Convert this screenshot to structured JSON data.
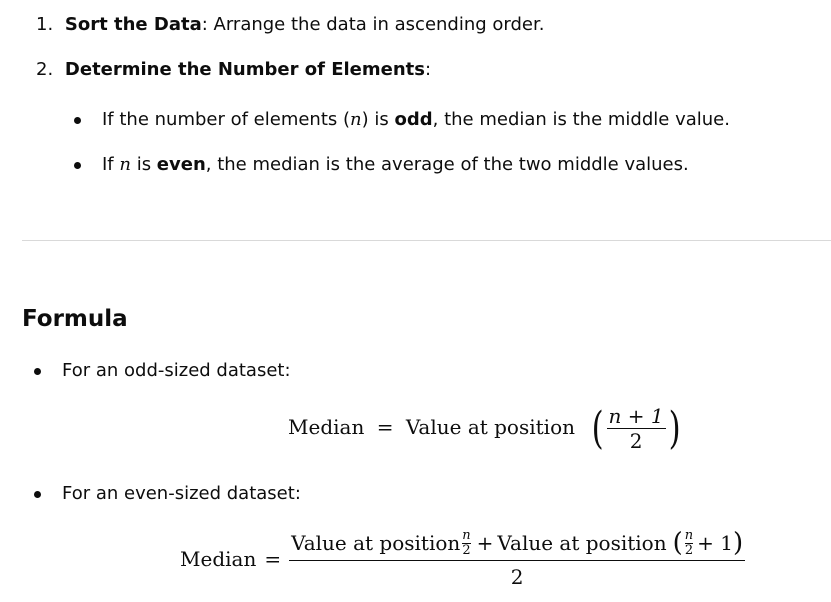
{
  "steps": [
    {
      "num": "1.",
      "title": "Sort the Data",
      "rest": ": Arrange the data in ascending order."
    },
    {
      "num": "2.",
      "title": "Determine the Number of Elements",
      "rest": ":"
    }
  ],
  "sub_bullets": {
    "odd": {
      "pre": "If the number of elements (",
      "var": "n",
      "mid": ") is ",
      "bold": "odd",
      "post": ", the median is the middle value."
    },
    "even": {
      "pre": "If ",
      "var": "n",
      "mid": " is ",
      "bold": "even",
      "post": ", the median is the average of the two middle values."
    }
  },
  "section_title": "Formula",
  "formula_bullets": {
    "odd": "For an odd-sized dataset:",
    "even": "For an even-sized dataset:"
  },
  "formula_odd": {
    "lhs": "Median",
    "eq": "=",
    "text": "Value at position",
    "num": "n + 1",
    "den": "2"
  },
  "formula_even": {
    "lhs": "Median",
    "eq": "=",
    "term1": "Value at position",
    "plus": "+",
    "term2": "Value at position",
    "frac_num": "n",
    "frac_den": "2",
    "plus_one": "+ 1",
    "den": "2"
  }
}
